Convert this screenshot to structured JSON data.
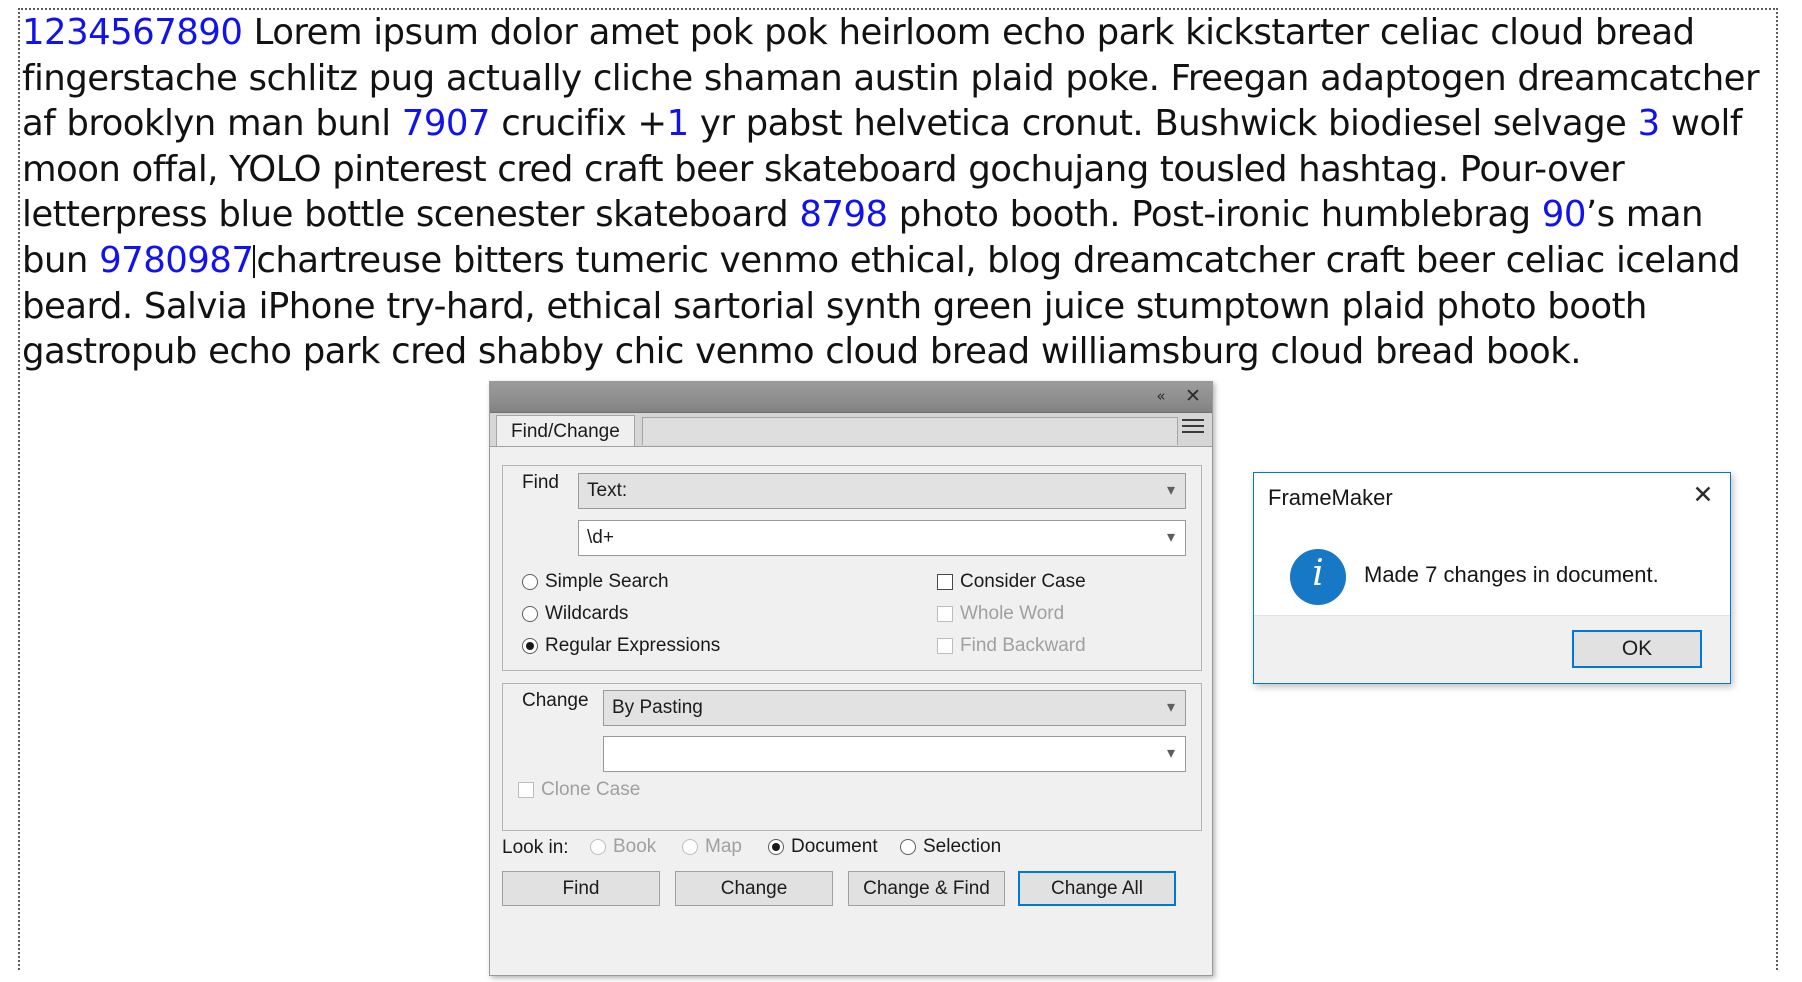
{
  "document": {
    "paragraph_runs": [
      {
        "t": "1234567890",
        "num": true
      },
      {
        "t": " Lorem ipsum dolor amet pok pok heirloom echo park kickstarter celiac cloud bread fingerstache schlitz pug actually cliche shaman austin plaid poke. Freegan adaptogen dreamcatcher af brooklyn man bunl ",
        "num": false
      },
      {
        "t": "7907",
        "num": true
      },
      {
        "t": "  crucifix +",
        "num": false
      },
      {
        "t": "1",
        "num": true
      },
      {
        "t": " yr pabst helvetica cronut. Bushwick biodiesel selvage ",
        "num": false
      },
      {
        "t": "3",
        "num": true
      },
      {
        "t": " wolf moon offal, YOLO pinterest cred craft beer skateboard gochujang tousled hashtag. Pour-over letterpress blue bottle scenester skateboard ",
        "num": false
      },
      {
        "t": "8798",
        "num": true
      },
      {
        "t": " photo booth. Post-ironic humblebrag ",
        "num": false
      },
      {
        "t": "90",
        "num": true
      },
      {
        "t": "’s man bun ",
        "num": false
      },
      {
        "t": "9780987",
        "num": true
      },
      {
        "t": "CARET",
        "num": false
      },
      {
        "t": "chartreuse bitters tumeric venmo ethical, blog dreamcatcher craft beer celiac iceland beard. Salvia iPhone try-hard, ethical sartorial synth green juice stumptown plaid photo booth gastropub echo park cred shabby chic venmo cloud bread williamsburg cloud bread book.",
        "num": false
      }
    ],
    "number_color": "#1212ee",
    "text_color": "#121212"
  },
  "find_change": {
    "tab_label": "Find/Change",
    "titlebar": {
      "collapse_icon": "«",
      "close_icon": "✕"
    },
    "find": {
      "group_label": "Find",
      "type_value": "Text:",
      "query_value": "\\d+",
      "modes": [
        {
          "label": "Simple Search",
          "selected": false,
          "disabled": false
        },
        {
          "label": "Wildcards",
          "selected": false,
          "disabled": false
        },
        {
          "label": "Regular Expressions",
          "selected": true,
          "disabled": false
        }
      ],
      "options": [
        {
          "label": "Consider Case",
          "checked": false,
          "disabled": false
        },
        {
          "label": "Whole Word",
          "checked": false,
          "disabled": true
        },
        {
          "label": "Find Backward",
          "checked": false,
          "disabled": true
        }
      ]
    },
    "change": {
      "group_label": "Change",
      "type_value": "By Pasting",
      "replacement_value": "",
      "clone_case": {
        "label": "Clone Case",
        "checked": false,
        "disabled": true
      }
    },
    "look_in": {
      "label": "Look in:",
      "options": [
        {
          "label": "Book",
          "selected": false,
          "disabled": true
        },
        {
          "label": "Map",
          "selected": false,
          "disabled": true
        },
        {
          "label": "Document",
          "selected": true,
          "disabled": false
        },
        {
          "label": "Selection",
          "selected": false,
          "disabled": false
        }
      ]
    },
    "buttons": [
      {
        "label": "Find",
        "focused": false
      },
      {
        "label": "Change",
        "focused": false
      },
      {
        "label": "Change & Find",
        "focused": false
      },
      {
        "label": "Change All",
        "focused": true
      }
    ]
  },
  "message_box": {
    "title": "FrameMaker",
    "close_icon": "✕",
    "icon": "info-icon",
    "message": "Made 7 changes in document.",
    "ok_label": "OK",
    "accent_color": "#0078d7",
    "icon_color": "#1778c6"
  }
}
